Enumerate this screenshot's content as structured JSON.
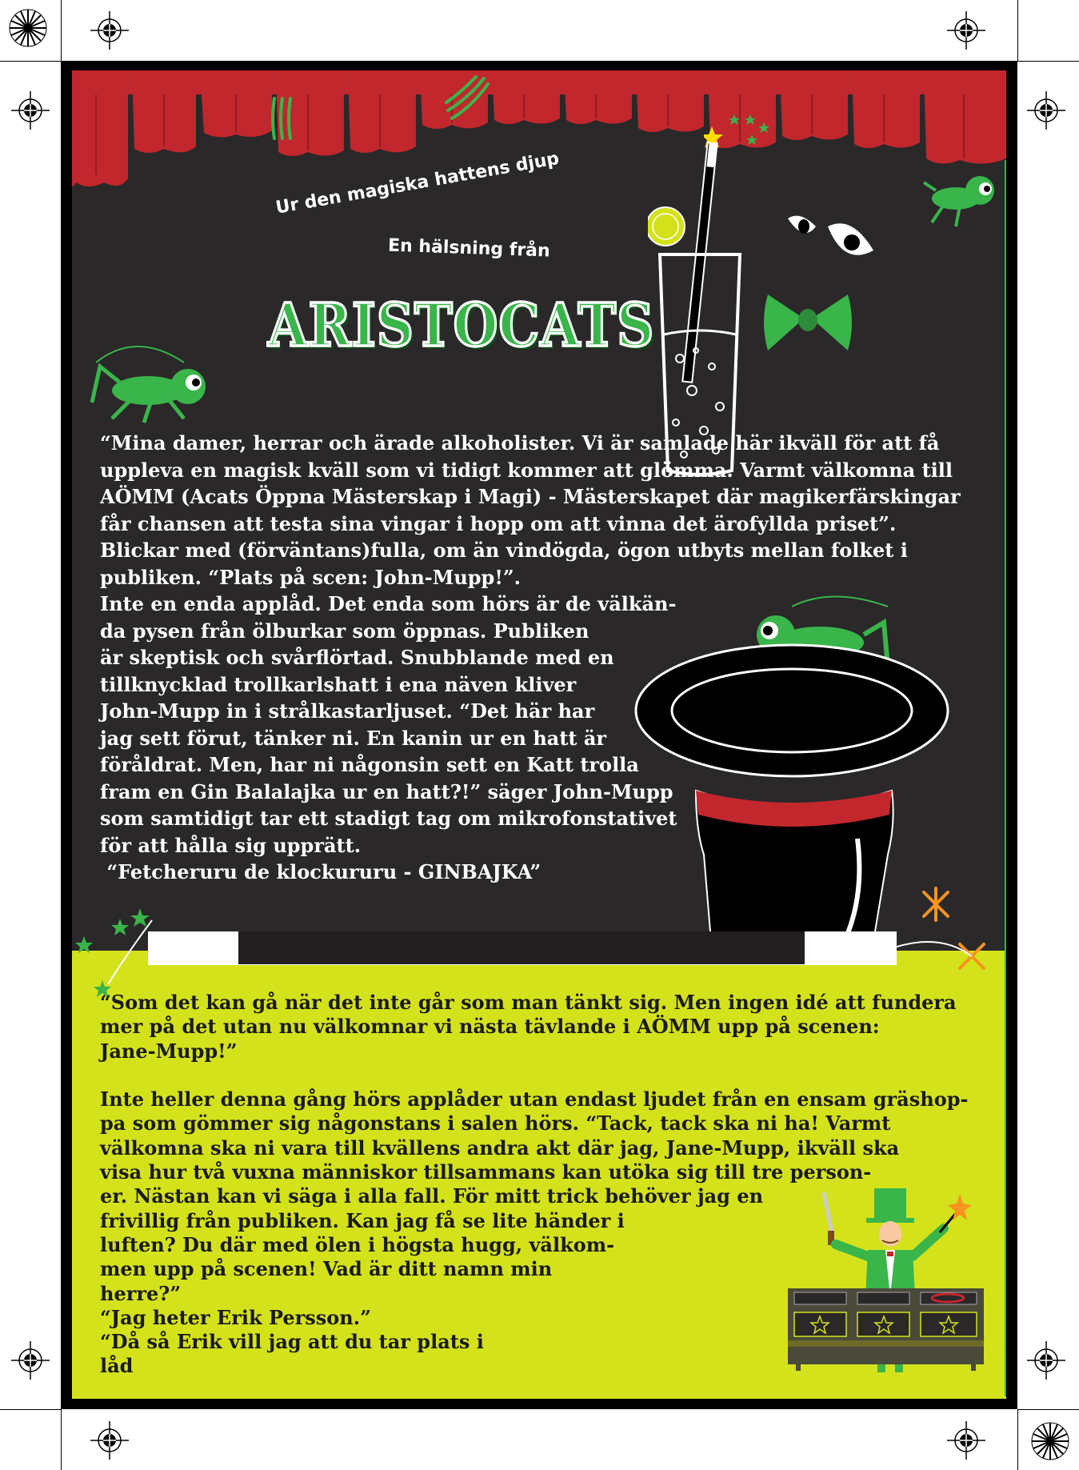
{
  "header": {
    "subtitle1": "Ur den magiska hattens djup",
    "subtitle2": "En hälsning från",
    "logo_text": "ARISTOCATS"
  },
  "story_white": [
    "“Mina damer, herrar och ärade alkoholister. Vi är samlade här ikväll för att få",
    "uppleva en magisk kväll som vi tidigt kommer att glömma. Varmt välkomna till",
    "AÖMM (Acats Öppna Mästerskap i Magi) - Mästerskapet där magikerfärskingar",
    "får chansen att testa sina vingar i hopp om att vinna det ärofyllda priset”.",
    "Blickar med (förväntans)fulla, om än vindögda, ögon utbyts mellan folket i",
    "publiken. “Plats på scen: John-Mupp!”.",
    "Inte en enda applåd. Det enda som hörs är de välkän-",
    "da pysen från ölburkar som öppnas. Publiken",
    "är skeptisk och svårflörtad. Snubblande med en",
    "tillknycklad trollkarlshatt i ena näven kliver",
    "John-Mupp in i strålkastarljuset. “Det här har",
    "jag sett förut, tänker ni. En kanin ur en hatt är",
    "föråldrat. Men, har ni någonsin sett en Katt trolla",
    "fram en Gin Balalajka ur en hatt?!” säger John-Mupp",
    "som samtidigt tar ett stadigt tag om mikrofonstativet",
    "för att hålla sig upprätt.",
    " “Fetcheruru de klockururu - GINBAJKA”"
  ],
  "story_black": [
    "“Som det kan gå när det inte går som man tänkt sig. Men ingen idé att fundera",
    "mer på det utan nu välkomnar vi nästa tävlande i AÖMM upp på scenen:",
    "Jane-Mupp!”",
    "",
    "Inte heller denna gång hörs applåder utan endast ljudet från en ensam gräshop-",
    "pa som gömmer sig någonstans i salen hörs. “Tack, tack ska ni ha! Varmt",
    "välkomna ska ni vara till kvällens andra akt där jag, Jane-Mupp, ikväll ska",
    "visa hur två vuxna människor tillsammans kan utöka sig till tre person-",
    "er. Nästan kan vi säga i alla fall. För mitt trick behöver jag en",
    "frivillig från publiken. Kan jag få se lite händer i",
    "luften? Du där med ölen i högsta hugg, välkom-",
    "men upp på scenen! Vad är ditt namn min",
    "herre?”",
    "“Jag heter Erik Persson.”",
    "“Då så Erik vill jag att du tar plats i",
    "låd"
  ],
  "colors": {
    "background_dark": "#2a2829",
    "curtain_red": "#c1272d",
    "lime": "#d4e21b",
    "logo_green": "#39b54a"
  },
  "icons": [
    "registration-mark",
    "curtain",
    "claw-marks",
    "grasshopper",
    "cocktail-glass",
    "magic-wand",
    "cat-eyes",
    "bow-tie",
    "top-hat",
    "sparkle-stars",
    "magician",
    "magic-box"
  ]
}
